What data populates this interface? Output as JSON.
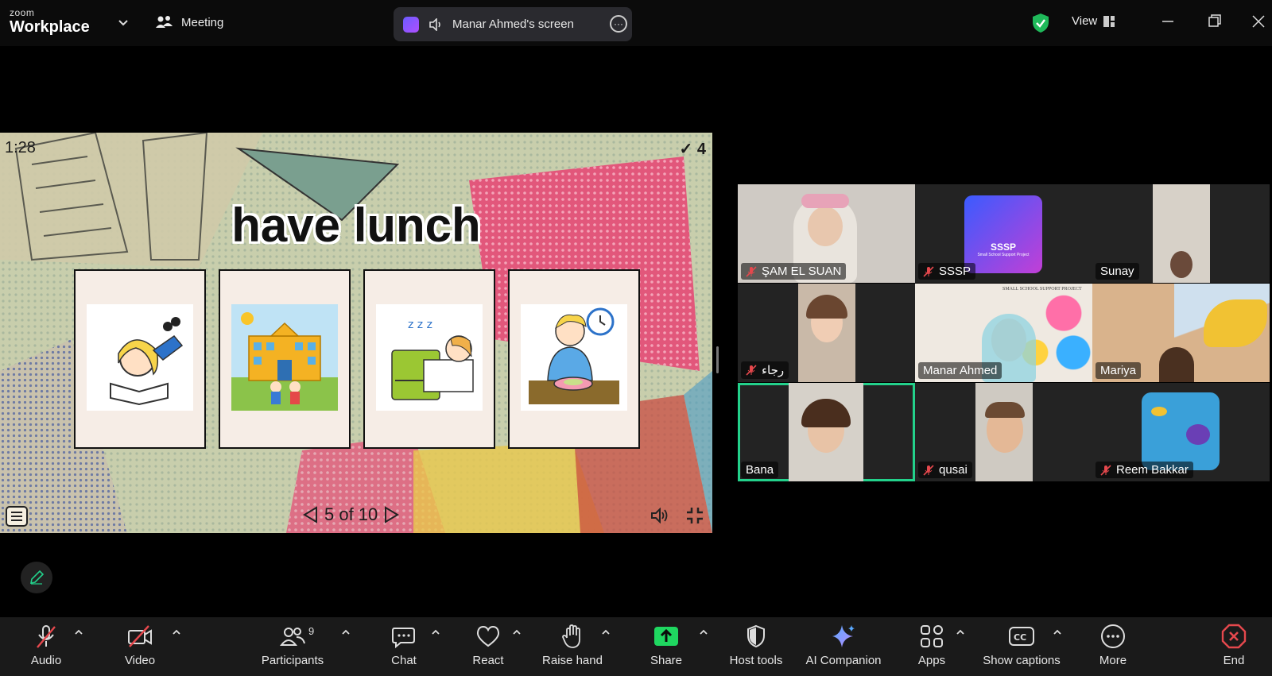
{
  "app": {
    "brand_small": "zoom",
    "brand_big": "Workplace",
    "meeting_label": "Meeting",
    "share_label": "Manar Ahmed's screen",
    "view_label": "View"
  },
  "slide": {
    "timer": "1:28",
    "score": "4",
    "title": "have lunch",
    "pager": "5 of 10",
    "cards": [
      {
        "icon": "girl-reading-icon"
      },
      {
        "icon": "school-icon"
      },
      {
        "icon": "sleeping-icon"
      },
      {
        "icon": "boy-eating-icon"
      }
    ]
  },
  "participants": [
    {
      "name": "ŞAM EL SUAN",
      "muted": true
    },
    {
      "name": "SSSP",
      "muted": true
    },
    {
      "name": "Sunay",
      "muted": false
    },
    {
      "name": "رجاء",
      "muted": true
    },
    {
      "name": "Manar Ahmed",
      "muted": false
    },
    {
      "name": "Mariya",
      "muted": false
    },
    {
      "name": "Bana",
      "muted": false,
      "active": true
    },
    {
      "name": "qusai",
      "muted": true
    },
    {
      "name": "Reem Bakkar",
      "muted": true
    }
  ],
  "sssp_logo_text": "SSSP",
  "sssp_logo_sub": "Small School Support Project",
  "banner_text": "SMALL SCHOOL SUPPORT PROJECT",
  "toolbar": {
    "audio": "Audio",
    "video": "Video",
    "participants": "Participants",
    "participants_count": "9",
    "chat": "Chat",
    "react": "React",
    "raise_hand": "Raise hand",
    "share": "Share",
    "host_tools": "Host tools",
    "ai_companion": "AI Companion",
    "apps": "Apps",
    "show_captions": "Show captions",
    "more": "More",
    "end": "End"
  },
  "colors": {
    "accent_green": "#23d18b",
    "share_green": "#1fd760",
    "end_red": "#e5484d",
    "mute_red": "#e5484d"
  }
}
